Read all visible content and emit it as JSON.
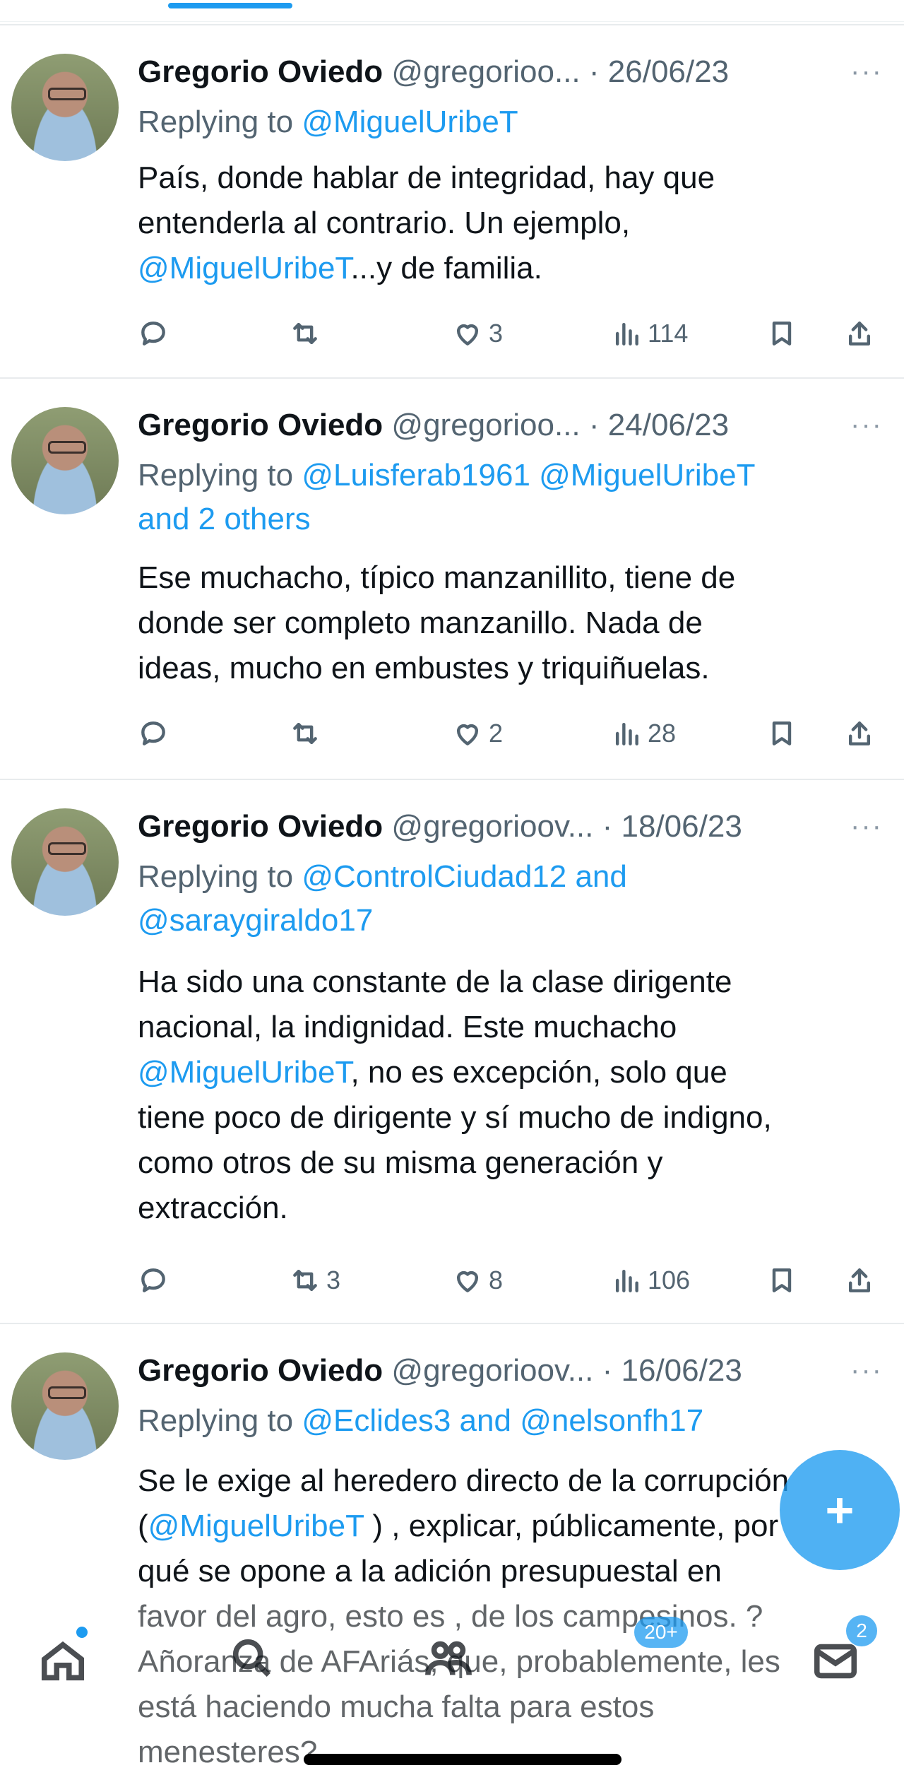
{
  "tweets": [
    {
      "name": "Gregorio Oviedo",
      "handle": "@gregorioo...",
      "sep": "·",
      "date": "26/06/23",
      "replying_prefix": "Replying to ",
      "replying_to": "@MiguelUribeT",
      "replying_more": "",
      "text_line1": "País, donde hablar de integridad, hay que",
      "text_line2": "entenderla al contrario. Un ejemplo,",
      "text_mention": "@MiguelUribeT",
      "text_after": "...y de familia.",
      "retweets": "",
      "likes": "3",
      "views": "114"
    },
    {
      "name": "Gregorio Oviedo",
      "handle": "@gregorioo...",
      "sep": "·",
      "date": "24/06/23",
      "replying_prefix": "Replying to ",
      "replying_to": "@Luisferab1961 @MiguelUribeT",
      "replying_more": "and 2 others",
      "text_line1": "Ese muchacho, típico manzanillito, tiene de",
      "text_line2": "donde ser completo manzanillo. Nada de",
      "text_line3": "ideas, mucho en embustes y triquiñuelas.",
      "retweets": "",
      "likes": "2",
      "views": "28"
    },
    {
      "name": "Gregorio Oviedo",
      "handle": "@gregorioov...",
      "sep": "·",
      "date": "18/06/23",
      "replying_prefix": "Replying to ",
      "replying_to": "@ControlCiudad12 and",
      "replying_more": "@saraygiraldo17",
      "text_line1": "Ha sido una constante de la clase dirigente",
      "text_line2": "nacional, la indignidad. Este muchacho",
      "text_mention": "@MiguelUribeT",
      "text_after": ", no es excepción, solo que",
      "text_line4": "tiene poco de dirigente y sí mucho de indigno,",
      "text_line5": "como otros de su misma generación y",
      "text_line6": "extracción.",
      "retweets": "3",
      "likes": "8",
      "views": "106"
    },
    {
      "name": "Gregorio Oviedo",
      "handle": "@gregorioov...",
      "sep": "·",
      "date": "16/06/23",
      "replying_prefix": "Replying to ",
      "replying_to": "@Eclides3 and @nelsonfh17",
      "text_line1": "Se le exige al heredero directo de la corrupción",
      "text_open": "(",
      "text_mention": "@MiguelUribeT",
      "text_after": " ) , explicar, públicamente, por",
      "text_line3": "qué se opone a la adición presupuestal en",
      "text_line4": "favor del agro, esto es , de los campesinos. ?",
      "text_line5": "Añoranza de AFAriás, que, probablemente, les",
      "text_line6": "está haciendo mucha falta para estos",
      "text_line7": "menesteres?"
    }
  ],
  "more_icon": "···",
  "fab_icon": "+",
  "nav": {
    "badge_communities": "20+",
    "badge_messages": "2"
  },
  "colors": {
    "accent": "#1d9bf0",
    "text": "#0f1419",
    "muted": "#536471"
  },
  "icons": [
    "reply-icon",
    "retweet-icon",
    "like-icon",
    "views-icon",
    "bookmark-icon",
    "share-icon",
    "home-icon",
    "search-icon",
    "communities-icon",
    "messages-icon"
  ]
}
